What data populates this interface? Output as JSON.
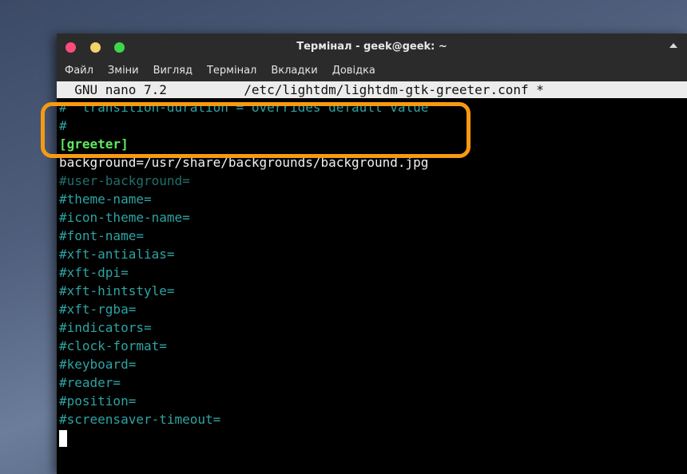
{
  "window": {
    "title": "Термінал - geek@geek: ~"
  },
  "menu": {
    "items": [
      "Файл",
      "Зміни",
      "Вигляд",
      "Термінал",
      "Вкладки",
      "Довідка"
    ]
  },
  "nano": {
    "header": "  GNU nano 7.2          /etc/lightdm/lightdm-gtk-greeter.conf *"
  },
  "lines": [
    "#  transition-duration = overrides default value",
    "#",
    "[greeter]",
    "background=/usr/share/backgrounds/background.jpg",
    "#user-background=",
    "#theme-name=",
    "#icon-theme-name=",
    "#font-name=",
    "#xft-antialias=",
    "#xft-dpi=",
    "#xft-hintstyle=",
    "#xft-rgba=",
    "#indicators=",
    "#clock-format=",
    "#keyboard=",
    "#reader=",
    "#position=",
    "#screensaver-timeout="
  ],
  "colors": {
    "comment": "#2ea3a3",
    "section": "#5ee85e",
    "value": "#f0f0f0",
    "highlight": "#f79a12"
  },
  "icons": {
    "close": "close-icon",
    "minimize": "minimize-icon",
    "maximize": "maximize-icon",
    "titlebar_menu": "chevron-up-icon"
  }
}
